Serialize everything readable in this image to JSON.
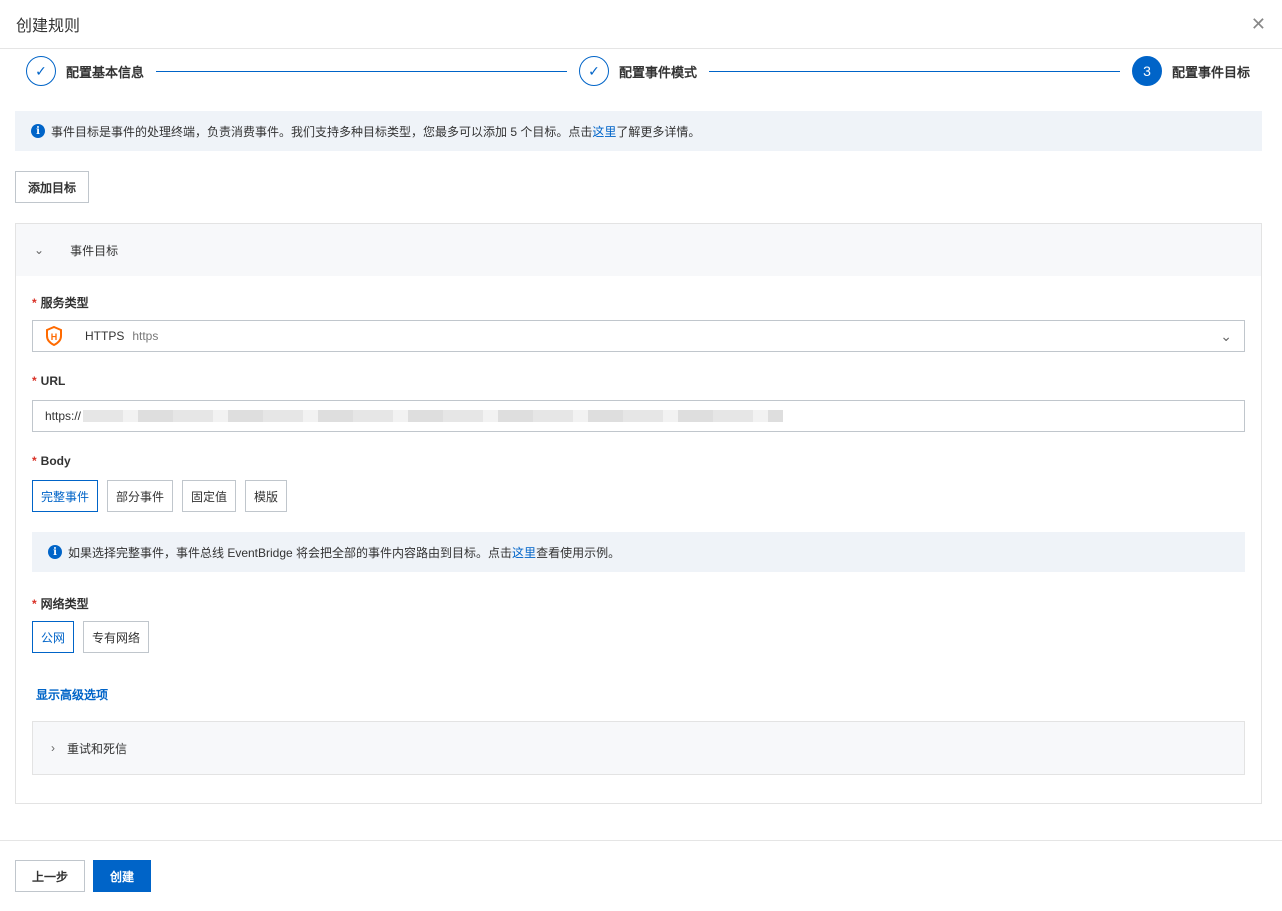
{
  "title": "创建规则",
  "steps": [
    {
      "label": "配置基本信息",
      "status": "done"
    },
    {
      "label": "配置事件模式",
      "status": "done"
    },
    {
      "label": "配置事件目标",
      "number": "3",
      "status": "active"
    }
  ],
  "notice": {
    "text": "事件目标是事件的处理终端，负责消费事件。我们支持多种目标类型，您最多可以添加 5 个目标。点击",
    "link": "这里",
    "suffix": "了解更多详情。"
  },
  "add_target": "添加目标",
  "panel": {
    "title": "事件目标",
    "service_label": "服务类型",
    "service_value": "HTTPS",
    "service_sub": "https",
    "url_label": "URL",
    "url_value": "https://",
    "body_label": "Body",
    "body_options": [
      "完整事件",
      "部分事件",
      "固定值",
      "模版"
    ],
    "body_notice": {
      "text": "如果选择完整事件，事件总线 EventBridge 将会把全部的事件内容路由到目标。点击",
      "link": "这里",
      "suffix": "查看使用示例。"
    },
    "network_label": "网络类型",
    "network_options": [
      "公网",
      "专有网络"
    ],
    "advanced": "显示高级选项",
    "retry": "重试和死信"
  },
  "footer": {
    "prev": "上一步",
    "create": "创建"
  },
  "colors": {
    "primary": "#0064c8",
    "required": "#d93026",
    "https_icon": "#ff6a00"
  }
}
